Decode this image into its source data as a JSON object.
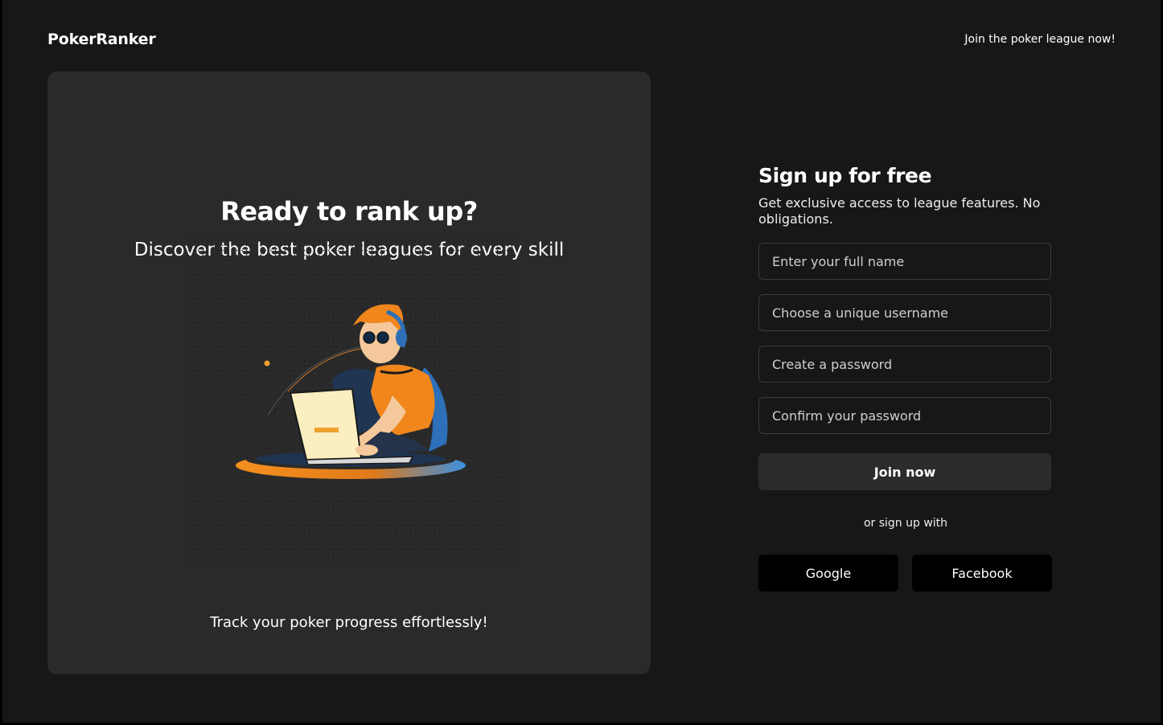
{
  "header": {
    "brand": "PokerRanker",
    "top_link": "Join the poker league now!"
  },
  "hero": {
    "title": "Ready to rank up?",
    "subtitle": "Discover the best poker leagues for every skill",
    "footer": "Track your poker progress effortlessly!",
    "illustration": "person-using-laptop-illustration"
  },
  "signup": {
    "title": "Sign up for free",
    "description": "Get exclusive access to league features. No obligations.",
    "fields": {
      "full_name_placeholder": "Enter your full name",
      "username_placeholder": "Choose a unique username",
      "password_placeholder": "Create a password",
      "confirm_password_placeholder": "Confirm your password"
    },
    "join_label": "Join now",
    "or_text": "or sign up with",
    "google_label": "Google",
    "facebook_label": "Facebook"
  },
  "colors": {
    "background": "#171717",
    "card": "#2a2a2a",
    "accent_orange": "#f08a24",
    "accent_blue": "#2e7fd6"
  }
}
